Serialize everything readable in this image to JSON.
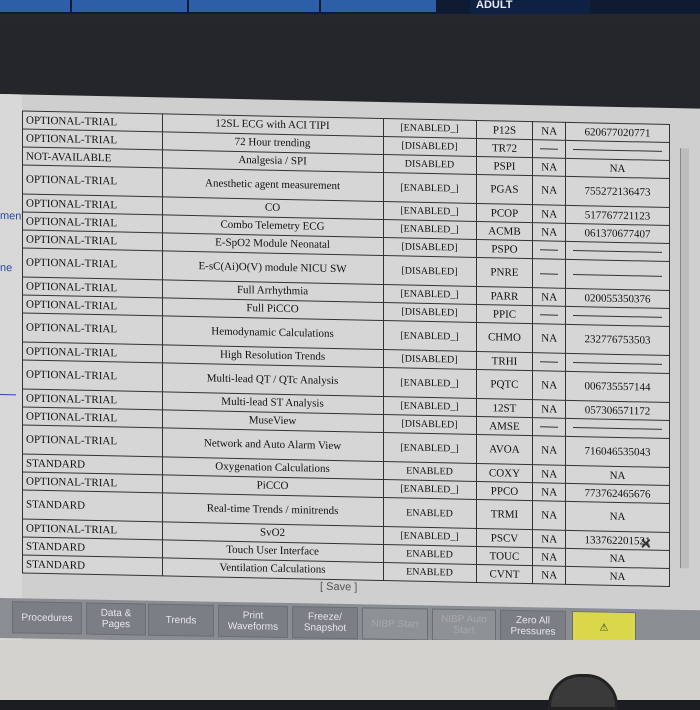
{
  "top_bar": {
    "mode_label": "ADULT"
  },
  "side_labels": [
    "ment",
    "ne"
  ],
  "rows": [
    {
      "status": "OPTIONAL-TRIAL",
      "feature": "12SL ECG with ACI TIPI",
      "state": "[ENABLED_]",
      "code": "P12S",
      "license_status": "NA",
      "key": "620677020771"
    },
    {
      "status": "OPTIONAL-TRIAL",
      "feature": "72 Hour trending",
      "state": "[DISABLED]",
      "code": "TR72",
      "license_status": "",
      "key": ""
    },
    {
      "status": "NOT-AVAILABLE",
      "feature": "Analgesia / SPI",
      "state": "DISABLED",
      "code": "PSPI",
      "license_status": "NA",
      "key": "NA"
    },
    {
      "status": "OPTIONAL-TRIAL",
      "feature": "Anesthetic agent measurement",
      "state": "[ENABLED_]",
      "code": "PGAS",
      "license_status": "NA",
      "key": "755272136473"
    },
    {
      "status": "OPTIONAL-TRIAL",
      "feature": "CO",
      "state": "[ENABLED_]",
      "code": "PCOP",
      "license_status": "NA",
      "key": "517767721123"
    },
    {
      "status": "OPTIONAL-TRIAL",
      "feature": "Combo Telemetry ECG",
      "state": "[ENABLED_]",
      "code": "ACMB",
      "license_status": "NA",
      "key": "061370677407"
    },
    {
      "status": "OPTIONAL-TRIAL",
      "feature": "E-SpO2 Module Neonatal",
      "state": "[DISABLED]",
      "code": "PSPO",
      "license_status": "",
      "key": ""
    },
    {
      "status": "OPTIONAL-TRIAL",
      "feature": "E-sC(Ai)O(V) module NICU SW",
      "state": "[DISABLED]",
      "code": "PNRE",
      "license_status": "",
      "key": ""
    },
    {
      "status": "OPTIONAL-TRIAL",
      "feature": "Full Arrhythmia",
      "state": "[ENABLED_]",
      "code": "PARR",
      "license_status": "NA",
      "key": "020055350376"
    },
    {
      "status": "OPTIONAL-TRIAL",
      "feature": "Full PiCCO",
      "state": "[DISABLED]",
      "code": "PPIC",
      "license_status": "",
      "key": ""
    },
    {
      "status": "OPTIONAL-TRIAL",
      "feature": "Hemodynamic Calculations",
      "state": "[ENABLED_]",
      "code": "CHMO",
      "license_status": "NA",
      "key": "232776753503"
    },
    {
      "status": "OPTIONAL-TRIAL",
      "feature": "High Resolution Trends",
      "state": "[DISABLED]",
      "code": "TRHI",
      "license_status": "",
      "key": ""
    },
    {
      "status": "OPTIONAL-TRIAL",
      "feature": "Multi-lead QT / QTc Analysis",
      "state": "[ENABLED_]",
      "code": "PQTC",
      "license_status": "NA",
      "key": "006735557144"
    },
    {
      "status": "OPTIONAL-TRIAL",
      "feature": "Multi-lead ST Analysis",
      "state": "[ENABLED_]",
      "code": "12ST",
      "license_status": "NA",
      "key": "057306571172"
    },
    {
      "status": "OPTIONAL-TRIAL",
      "feature": "MuseView",
      "state": "[DISABLED]",
      "code": "AMSE",
      "license_status": "",
      "key": ""
    },
    {
      "status": "OPTIONAL-TRIAL",
      "feature": "Network and Auto Alarm View",
      "state": "[ENABLED_]",
      "code": "AVOA",
      "license_status": "NA",
      "key": "716046535043"
    },
    {
      "status": "STANDARD",
      "feature": "Oxygenation Calculations",
      "state": "ENABLED",
      "code": "COXY",
      "license_status": "NA",
      "key": "NA"
    },
    {
      "status": "OPTIONAL-TRIAL",
      "feature": "PiCCO",
      "state": "[ENABLED_]",
      "code": "PPCO",
      "license_status": "NA",
      "key": "773762465676"
    },
    {
      "status": "STANDARD",
      "feature": "Real-time Trends / minitrends",
      "state": "ENABLED",
      "code": "TRMI",
      "license_status": "NA",
      "key": "NA"
    },
    {
      "status": "OPTIONAL-TRIAL",
      "feature": "SvO2",
      "state": "[ENABLED_]",
      "code": "PSCV",
      "license_status": "NA",
      "key": "133762201521"
    },
    {
      "status": "STANDARD",
      "feature": "Touch User Interface",
      "state": "ENABLED",
      "code": "TOUC",
      "license_status": "NA",
      "key": "NA"
    },
    {
      "status": "STANDARD",
      "feature": "Ventilation Calculations",
      "state": "ENABLED",
      "code": "CVNT",
      "license_status": "NA",
      "key": "NA"
    }
  ],
  "save_label": "[ Save ]",
  "toolbar": [
    {
      "label": "Procedures",
      "dim": false
    },
    {
      "label": "Data & Pages",
      "dim": false
    },
    {
      "label": "Trends",
      "dim": false
    },
    {
      "label": "Print Waveforms",
      "dim": false
    },
    {
      "label": "Freeze/ Snapshot",
      "dim": false
    },
    {
      "label": "NIBP Start",
      "dim": true
    },
    {
      "label": "NIBP Auto Start",
      "dim": true
    },
    {
      "label": "Zero All Pressures",
      "dim": false
    }
  ],
  "colors": {
    "screen": "#cfcfcf",
    "toolbar": "#8a8d92",
    "alarm": "#d9d84a",
    "top_tab": "#2d5fa8"
  }
}
